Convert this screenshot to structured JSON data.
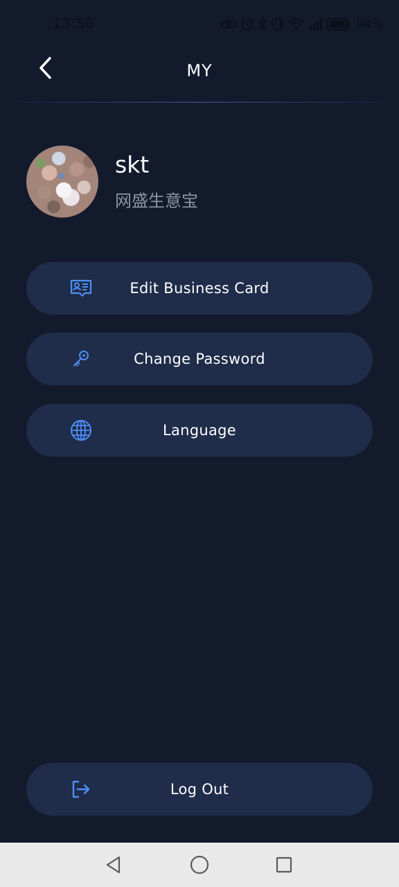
{
  "status_bar": {
    "time": "13:56",
    "battery_text": "94%",
    "icons": [
      "eye-icon",
      "alarm-icon",
      "bluetooth-icon",
      "vibrate-icon",
      "wifi-icon",
      "cellular-signal-icon",
      "battery-icon"
    ]
  },
  "header": {
    "title": "MY",
    "back_icon": "chevron-left-icon"
  },
  "profile": {
    "name": "skt",
    "company": "网盛生意宝"
  },
  "menu": {
    "items": [
      {
        "label": "Edit Business Card",
        "icon": "business-card-icon"
      },
      {
        "label": "Change Password",
        "icon": "key-icon"
      },
      {
        "label": "Language",
        "icon": "globe-icon"
      }
    ],
    "logout": {
      "label": "Log Out",
      "icon": "logout-icon"
    }
  },
  "theme": {
    "background": "#131a2c",
    "button_bg": "#1f2c4a",
    "accent": "#4f8ff7",
    "secondary_text": "#8d94a3"
  },
  "nav_bar": {
    "icons": [
      "back-triangle-icon",
      "home-circle-icon",
      "recents-square-icon"
    ]
  }
}
